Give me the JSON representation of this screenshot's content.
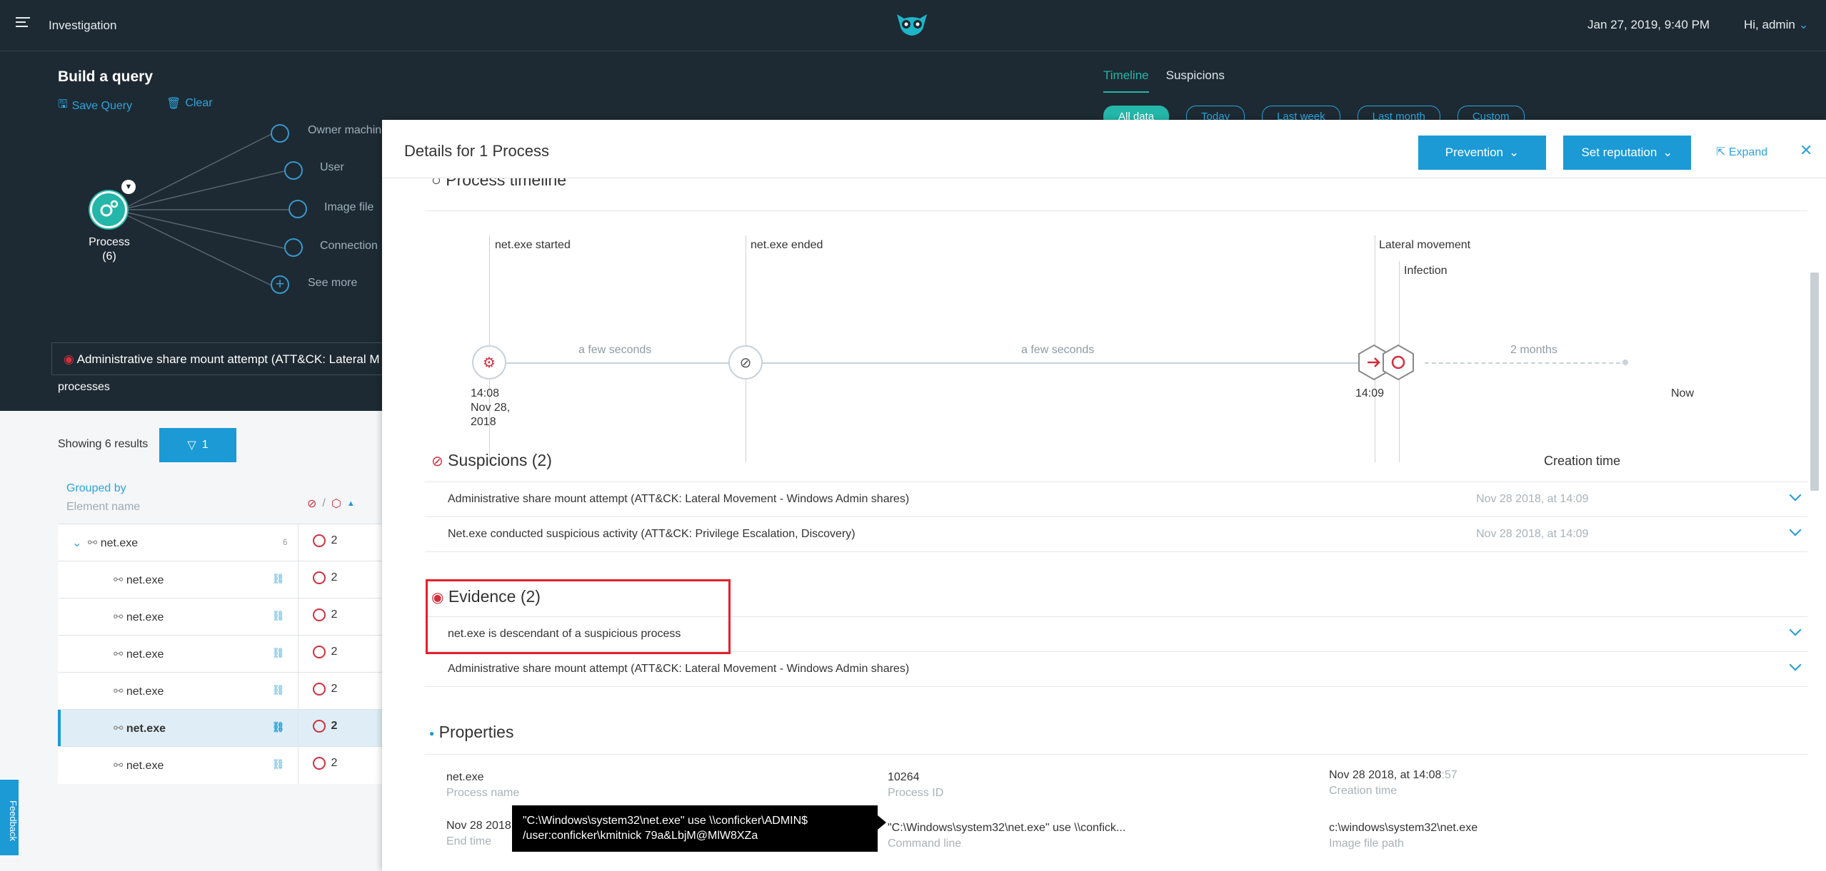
{
  "topbar": {
    "title": "Investigation",
    "date": "Jan 27, 2019, 9:40 PM",
    "user": "Hi, admin"
  },
  "query": {
    "heading": "Build a query",
    "save_label": "Save Query",
    "clear_label": "Clear",
    "graph_nodes": [
      "Owner machin",
      "User",
      "Image file",
      "Connection",
      "See more"
    ],
    "process_label": "Process",
    "process_count": "(6)",
    "chip": "Administrative share mount attempt (ATT&CK: Lateral M",
    "processes_label": "processes",
    "tabs": [
      "Timeline",
      "Suspicions"
    ],
    "pills": [
      "All data",
      "Today",
      "Last week",
      "Last month",
      "Custom"
    ]
  },
  "results": {
    "showing": "Showing 6 results",
    "filter_count": "1",
    "grouped_by": "Grouped by",
    "element_name": "Element name",
    "group": {
      "name": "net.exe",
      "count": "6",
      "suspicions": "2"
    },
    "rows": [
      {
        "name": "net.exe",
        "suspicions": "2"
      },
      {
        "name": "net.exe",
        "suspicions": "2"
      },
      {
        "name": "net.exe",
        "suspicions": "2"
      },
      {
        "name": "net.exe",
        "suspicions": "2"
      },
      {
        "name": "net.exe",
        "suspicions": "2"
      },
      {
        "name": "net.exe",
        "suspicions": "2"
      }
    ]
  },
  "feedback": "Feedback",
  "detail": {
    "title": "Details for 1 Process",
    "prevention": "Prevention",
    "set_reputation": "Set reputation",
    "expand": "Expand",
    "timeline_title": "Process timeline",
    "timeline": {
      "started": "net.exe started",
      "ended": "net.exe ended",
      "lateral": "Lateral movement",
      "infection": "Infection",
      "gap1": "a few seconds",
      "gap2": "a few seconds",
      "gap3": "2 months",
      "t_start": "14:08",
      "t_start_date": "Nov 28,",
      "t_start_year": "2018",
      "t_mid": "14:09",
      "t_now": "Now"
    },
    "suspicions": {
      "title": "Suspicions (2)",
      "creation_header": "Creation time",
      "items": [
        {
          "text": "Administrative share mount attempt (ATT&CK: Lateral Movement - Windows Admin shares)",
          "date": "Nov 28 2018, at 14:09"
        },
        {
          "text": "Net.exe conducted suspicious activity (ATT&CK: Privilege Escalation, Discovery)",
          "date": "Nov 28 2018, at 14:09"
        }
      ]
    },
    "evidence": {
      "title": "Evidence (2)",
      "items": [
        {
          "text": "net.exe is descendant of a suspicious process"
        },
        {
          "text": "Administrative share mount attempt (ATT&CK: Lateral Movement - Windows Admin shares)"
        }
      ]
    },
    "properties": {
      "title": "Properties",
      "process_name": {
        "value": "net.exe",
        "label": "Process name"
      },
      "process_id": {
        "value": "10264",
        "label": "Process ID"
      },
      "creation_time": {
        "value": "Nov 28 2018, at 14:08",
        "value_sec": ":57",
        "label": "Creation time"
      },
      "end_time": {
        "value": "Nov 28 2018",
        "label": "End time"
      },
      "command_line": {
        "value": "\"C:\\Windows\\system32\\net.exe\" use \\\\confick...",
        "label": "Command line"
      },
      "image_path": {
        "value": "c:\\windows\\system32\\net.exe",
        "label": "Image file path"
      }
    },
    "tooltip": "\"C:\\Windows\\system32\\net.exe\" use \\\\conficker\\ADMIN$ /user:conficker\\kmitnick 79a&LbjM@MlW8XZa"
  }
}
